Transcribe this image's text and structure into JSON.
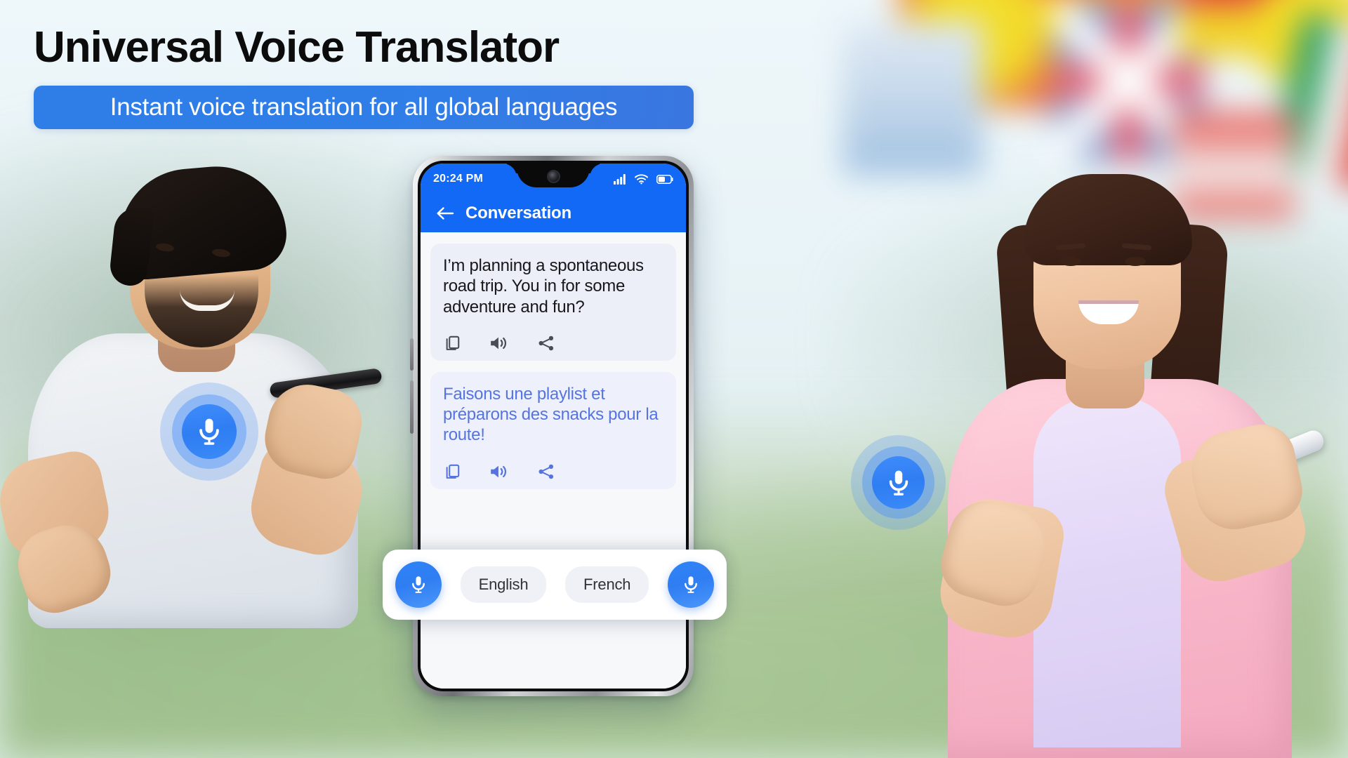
{
  "hero": {
    "headline": "Universal Voice Translator",
    "subtitle": "Instant voice translation for all global languages",
    "accent_color": "#2f7ee8",
    "headline_color": "#0c0c0c",
    "subtitle_color": "#ffffff"
  },
  "phone": {
    "statusbar": {
      "time": "20:24 PM",
      "icons": [
        "signal-bars-icon",
        "wifi-icon",
        "battery-icon"
      ],
      "background_color": "#1169f5"
    },
    "appbar": {
      "back_icon": "back-arrow-icon",
      "title": "Conversation",
      "background_color": "#1169f5",
      "title_color": "#ffffff"
    },
    "conversation": [
      {
        "role": "source",
        "language": "English",
        "text": "I’m planning a spontaneous road trip. You in for some adventure and fun?",
        "text_color": "#17181b",
        "bubble_color": "#eceff7",
        "actions": [
          "copy-icon",
          "speaker-icon",
          "share-icon"
        ],
        "action_color": "#4a4d55"
      },
      {
        "role": "target",
        "language": "French",
        "text": "Faisons une playlist et préparons des snacks pour la route!",
        "text_color": "#5574e0",
        "bubble_color": "#eef1fb",
        "actions": [
          "copy-icon",
          "speaker-icon",
          "share-icon"
        ],
        "action_color": "#5574e0"
      }
    ]
  },
  "control_bar": {
    "mic_left_icon": "microphone-icon",
    "mic_right_icon": "microphone-icon",
    "languages": [
      {
        "label": "English"
      },
      {
        "label": "French"
      }
    ],
    "pill_color": "#eff1f6",
    "mic_color": "#2f84f7"
  },
  "badges": [
    {
      "name": "mic-badge-left",
      "icon": "microphone-icon",
      "color": "#3f8dfb"
    },
    {
      "name": "mic-badge-right",
      "icon": "microphone-icon",
      "color": "#3f8dfb"
    }
  ],
  "people": [
    {
      "name": "person-left-man",
      "description": "man-speaking-into-phone"
    },
    {
      "name": "person-right-woman",
      "description": "woman-speaking-into-phone"
    }
  ],
  "background": {
    "description": "blurred-world-flags-and-outdoor-scene",
    "flag_colors": [
      "#f0d81f",
      "#e8473f",
      "#2a5fb0",
      "#1f9a58",
      "#ffffff",
      "#151515",
      "#e8a020"
    ]
  }
}
